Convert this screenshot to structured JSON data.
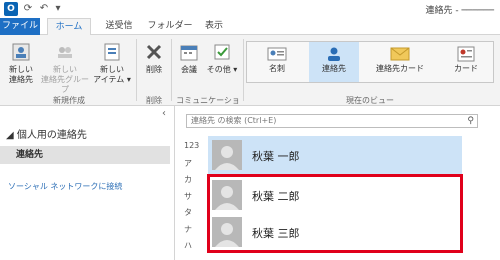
{
  "window": {
    "title": "連絡先 - ──────"
  },
  "tabs": [
    {
      "label": "ファイル"
    },
    {
      "label": "ホーム"
    },
    {
      "label": "送受信"
    },
    {
      "label": "フォルダー"
    },
    {
      "label": "表示"
    }
  ],
  "ribbon": {
    "new_contact": "新しい\n連絡先",
    "new_group": "新しい\n連絡先グループ",
    "new_items": "新しい\nアイテム",
    "delete": "削除",
    "meeting": "会議",
    "other": "その他",
    "groups": {
      "new": "新規作成",
      "delete": "削除",
      "communication": "コミュニケーション",
      "current_view": "現在のビュー"
    },
    "views": [
      {
        "label": "名刺"
      },
      {
        "label": "連絡先"
      },
      {
        "label": "連絡先カード"
      },
      {
        "label": "カード"
      }
    ],
    "active_view": "連絡先"
  },
  "left_pane": {
    "header": "◢ 個人用の連絡先",
    "folder": "連絡先",
    "social_link": "ソーシャル ネットワークに接続"
  },
  "search": {
    "placeholder": "連絡先 の検索 (Ctrl+E)"
  },
  "index": [
    "123",
    "ア",
    "カ",
    "サ",
    "タ",
    "ナ",
    "ハ"
  ],
  "contacts": [
    {
      "name": "秋葉 一郎",
      "selected": true
    },
    {
      "name": "秋葉 二郎",
      "selected": false
    },
    {
      "name": "秋葉 三郎",
      "selected": false
    }
  ],
  "colors": {
    "accent": "#1e6fc4",
    "selected": "#cde3f7",
    "highlight": "#e0001b"
  }
}
